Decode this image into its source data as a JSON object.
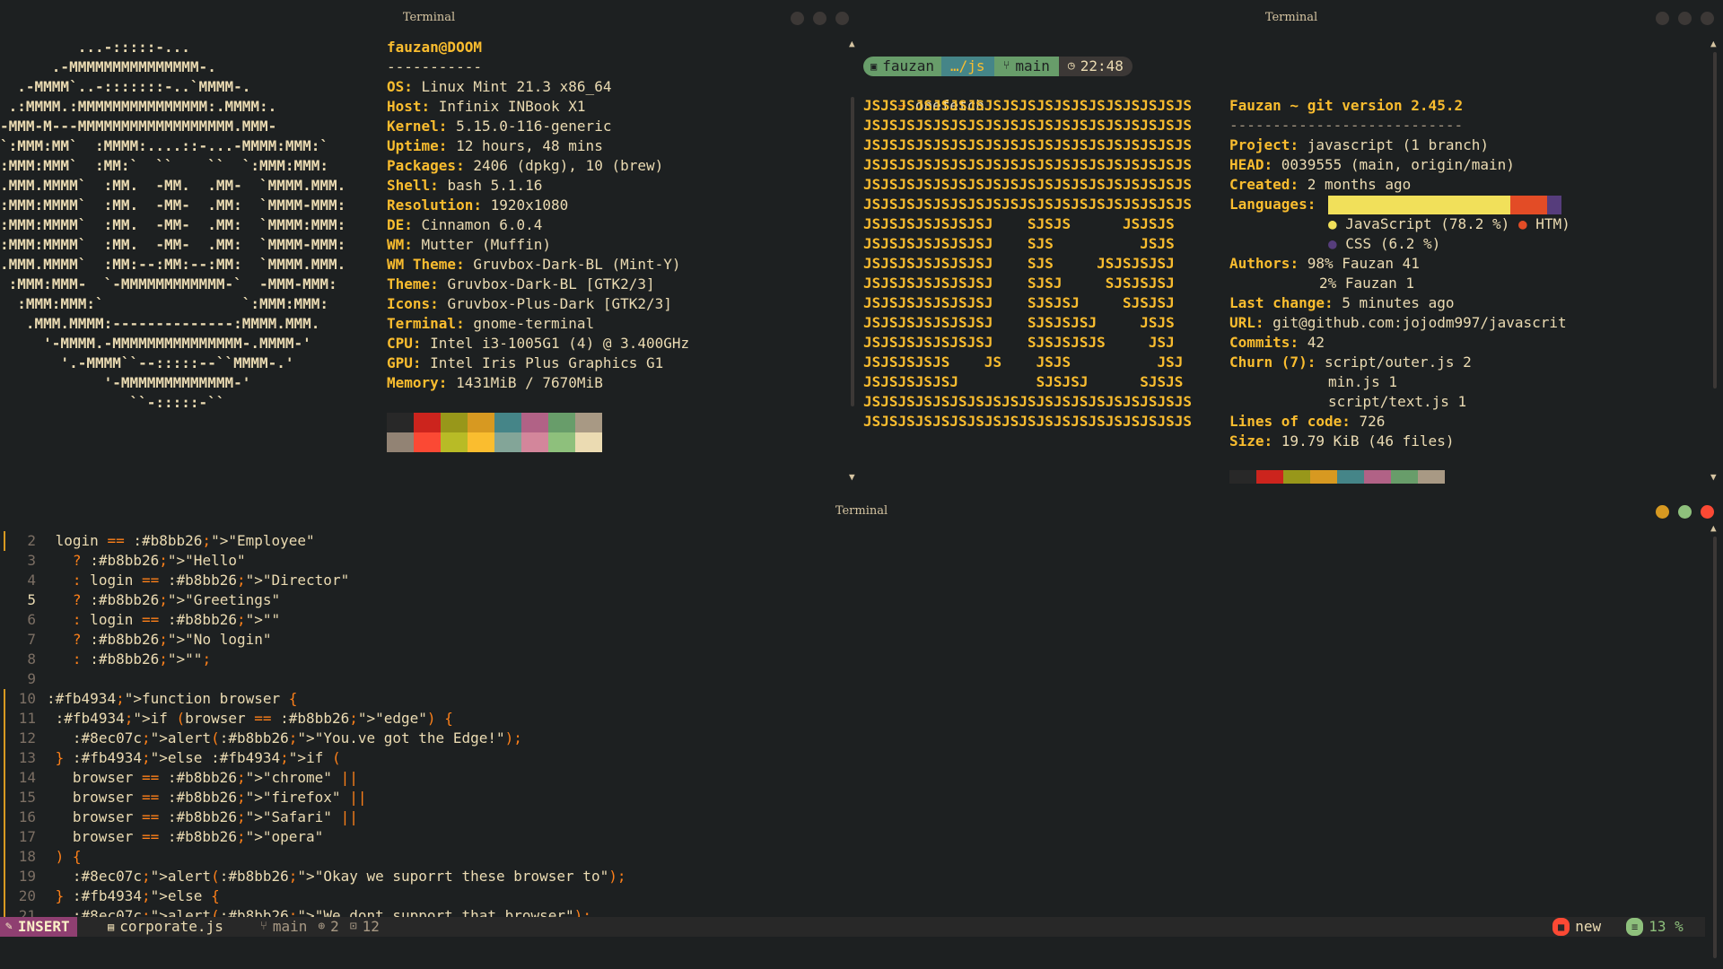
{
  "neofetch_window": {
    "title": "Terminal"
  },
  "onefetch_window": {
    "title": "Terminal"
  },
  "editor_window": {
    "title": "Terminal"
  },
  "neofetch": {
    "ascii": [
      "         ...-:::::-...",
      "      .-MMMMMMMMMMMMMMM-.",
      "  .-MMMM`..-:::::::-..`MMMM-.",
      " .:MMMM.:MMMMMMMMMMMMMMM:.MMMM:.",
      "-MMM-M---MMMMMMMMMMMMMMMMMM.MMM-",
      "`:MMM:MM`  :MMMM:....::-...-MMMM:MMM:`",
      ":MMM:MMM`  :MM:`  ``    ``  `:MMM:MMM:",
      ".MMM.MMMM`  :MM.  -MM.  .MM-  `MMMM.MMM.",
      ":MMM:MMMM`  :MM.  -MM-  .MM:  `MMMM-MMM:",
      ":MMM:MMMM`  :MM.  -MM-  .MM:  `MMMM:MMM:",
      ":MMM:MMMM`  :MM.  -MM-  .MM:  `MMMM-MMM:",
      ".MMM.MMMM`  :MM:--:MM:--:MM:  `MMMM.MMM.",
      " :MMM:MMM-  `-MMMMMMMMMMMM-`  -MMM-MMM:",
      "  :MMM:MMM:`                `:MMM:MMM:",
      "   .MMM.MMMM:--------------:MMMM.MMM.",
      "     '-MMMM.-MMMMMMMMMMMMMMM-.MMMM-'",
      "       '.-MMMM``--:::::--``MMMM-.'",
      "            '-MMMMMMMMMMMMM-'",
      "               ``-:::::-``"
    ],
    "user": "fauzan@DOOM",
    "separator": "-----------",
    "info": [
      {
        "k": "OS",
        "v": "Linux Mint 21.3 x86_64"
      },
      {
        "k": "Host",
        "v": "Infinix INBook X1"
      },
      {
        "k": "Kernel",
        "v": "5.15.0-116-generic"
      },
      {
        "k": "Uptime",
        "v": "12 hours, 48 mins"
      },
      {
        "k": "Packages",
        "v": "2406 (dpkg), 10 (brew)"
      },
      {
        "k": "Shell",
        "v": "bash 5.1.16"
      },
      {
        "k": "Resolution",
        "v": "1920x1080"
      },
      {
        "k": "DE",
        "v": "Cinnamon 6.0.4"
      },
      {
        "k": "WM",
        "v": "Mutter (Muffin)"
      },
      {
        "k": "WM Theme",
        "v": "Gruvbox-Dark-BL (Mint-Y)"
      },
      {
        "k": "Theme",
        "v": "Gruvbox-Dark-BL [GTK2/3]"
      },
      {
        "k": "Icons",
        "v": "Gruvbox-Plus-Dark [GTK2/3]"
      },
      {
        "k": "Terminal",
        "v": "gnome-terminal"
      },
      {
        "k": "CPU",
        "v": "Intel i3-1005G1 (4) @ 3.400GHz"
      },
      {
        "k": "GPU",
        "v": "Intel Iris Plus Graphics G1"
      },
      {
        "k": "Memory",
        "v": "1431MiB / 7670MiB"
      }
    ],
    "palette_top": [
      "#282828",
      "#cc241d",
      "#98971a",
      "#d79921",
      "#458588",
      "#b16286",
      "#689d6a",
      "#a89984"
    ],
    "palette_bottom": [
      "#928374",
      "#fb4934",
      "#b8bb26",
      "#fabd2f",
      "#83a598",
      "#d3869b",
      "#8ec07c",
      "#ebdbb2"
    ]
  },
  "prompt": {
    "user": "fauzan",
    "dir": "…/js",
    "branch": "main",
    "time": "22:48",
    "command": "onefetch"
  },
  "onefetch": {
    "ascii": [
      "JSJSJSJSJSJSJSJSJSJSJSJSJSJSJSJSJSJSJS",
      "JSJSJSJSJSJSJSJSJSJSJSJSJSJSJSJSJSJSJS",
      "JSJSJSJSJSJSJSJSJSJSJSJSJSJSJSJSJSJSJS",
      "JSJSJSJSJSJSJSJSJSJSJSJSJSJSJSJSJSJSJS",
      "JSJSJSJSJSJSJSJSJSJSJSJSJSJSJSJSJSJSJS",
      "JSJSJSJSJSJSJSJSJSJSJSJSJSJSJSJSJSJSJS",
      "JSJSJSJSJSJSJSJ    SJSJS      JSJSJS",
      "JSJSJSJSJSJSJSJ    SJS          JSJS",
      "JSJSJSJSJSJSJSJ    SJS     JSJSJSJSJ",
      "JSJSJSJSJSJSJSJ    SJSJ     SJSJSJSJ",
      "JSJSJSJSJSJSJSJ    SJSJSJ     SJSJSJ",
      "JSJSJSJSJSJSJSJ    SJSJSJSJ     JSJS",
      "JSJSJSJSJSJSJSJ    SJSJSJSJS     JSJ",
      "JSJSJSJSJS    JS    JSJS          JSJ",
      "JSJSJSJSJSJ         SJSJSJ      SJSJS",
      "JSJSJSJSJSJSJSJSJSJSJSJSJSJSJSJSJSJSJS",
      "JSJSJSJSJSJSJSJSJSJSJSJSJSJSJSJSJSJSJS"
    ],
    "header": "Fauzan ~ git version 2.45.2",
    "underline": "---------------------------",
    "project_k": "Project",
    "project_v": "javascript (1 branch)",
    "head_k": "HEAD",
    "head_v": "0039555 (main, origin/main)",
    "created_k": "Created",
    "created_v": "2 months ago",
    "languages_k": "Languages",
    "lang1": "JavaScript (78.2 %)",
    "lang2": "HTM)",
    "lang3": "CSS (6.2 %)",
    "lang_share": {
      "javascript": 0.782,
      "html": 0.156,
      "css": 0.062
    },
    "lang_colors": {
      "javascript": "#f1e05a",
      "html": "#e34c26",
      "css": "#563d7c"
    },
    "authors_k": "Authors",
    "author1": "98% Fauzan 41",
    "author2": "2% Fauzan 1",
    "lastchange_k": "Last change",
    "lastchange_v": "5 minutes ago",
    "url_k": "URL",
    "url_v": "git@github.com:jojodm997/javascrit",
    "commits_k": "Commits",
    "commits_v": "42",
    "churn_k": "Churn (7)",
    "churn1": "script/outer.js 2",
    "churn2": "min.js 1",
    "churn3": "script/text.js 1",
    "loc_k": "Lines of code",
    "loc_v": "726",
    "size_k": "Size",
    "size_v": "19.79 KiB (46 files)",
    "palette": [
      "#282828",
      "#cc241d",
      "#98971a",
      "#d79921",
      "#458588",
      "#b16286",
      "#689d6a",
      "#a89984"
    ]
  },
  "editor": {
    "lines": [
      {
        "n": "2",
        "t": " login == \"Employee\""
      },
      {
        "n": "3",
        "t": "   ? \"Hello\""
      },
      {
        "n": "4",
        "t": "   : login == \"Director\""
      },
      {
        "n": "5",
        "t": "   ? \"Greetings\""
      },
      {
        "n": "6",
        "t": "   : login == \"\""
      },
      {
        "n": "7",
        "t": "   ? \"No login\""
      },
      {
        "n": "8",
        "t": "   : \"\";"
      },
      {
        "n": "9",
        "t": ""
      },
      {
        "n": "10",
        "t": "function browser {"
      },
      {
        "n": "11",
        "t": " if (browser == \"edge\") {"
      },
      {
        "n": "12",
        "t": "   alert(\"You.ve got the Edge!\");"
      },
      {
        "n": "13",
        "t": " } else if ("
      },
      {
        "n": "14",
        "t": "   browser == \"chrome\" ||"
      },
      {
        "n": "15",
        "t": "   browser == \"firefox\" ||"
      },
      {
        "n": "16",
        "t": "   browser == \"Safari\" ||"
      },
      {
        "n": "17",
        "t": "   browser == \"opera\""
      },
      {
        "n": "18",
        "t": " ) {"
      },
      {
        "n": "19",
        "t": "   alert(\"Okay we suporrt these browser to\");"
      },
      {
        "n": "20",
        "t": " } else {"
      },
      {
        "n": "21",
        "t": "   alert(\"We dont support that browser\");"
      }
    ],
    "current_line": "5"
  },
  "statusline": {
    "mode": "INSERT",
    "file": "corporate.js",
    "branch": "main",
    "changes": "2",
    "errors": "12",
    "buffer_state": "new",
    "percent": "13 %"
  }
}
